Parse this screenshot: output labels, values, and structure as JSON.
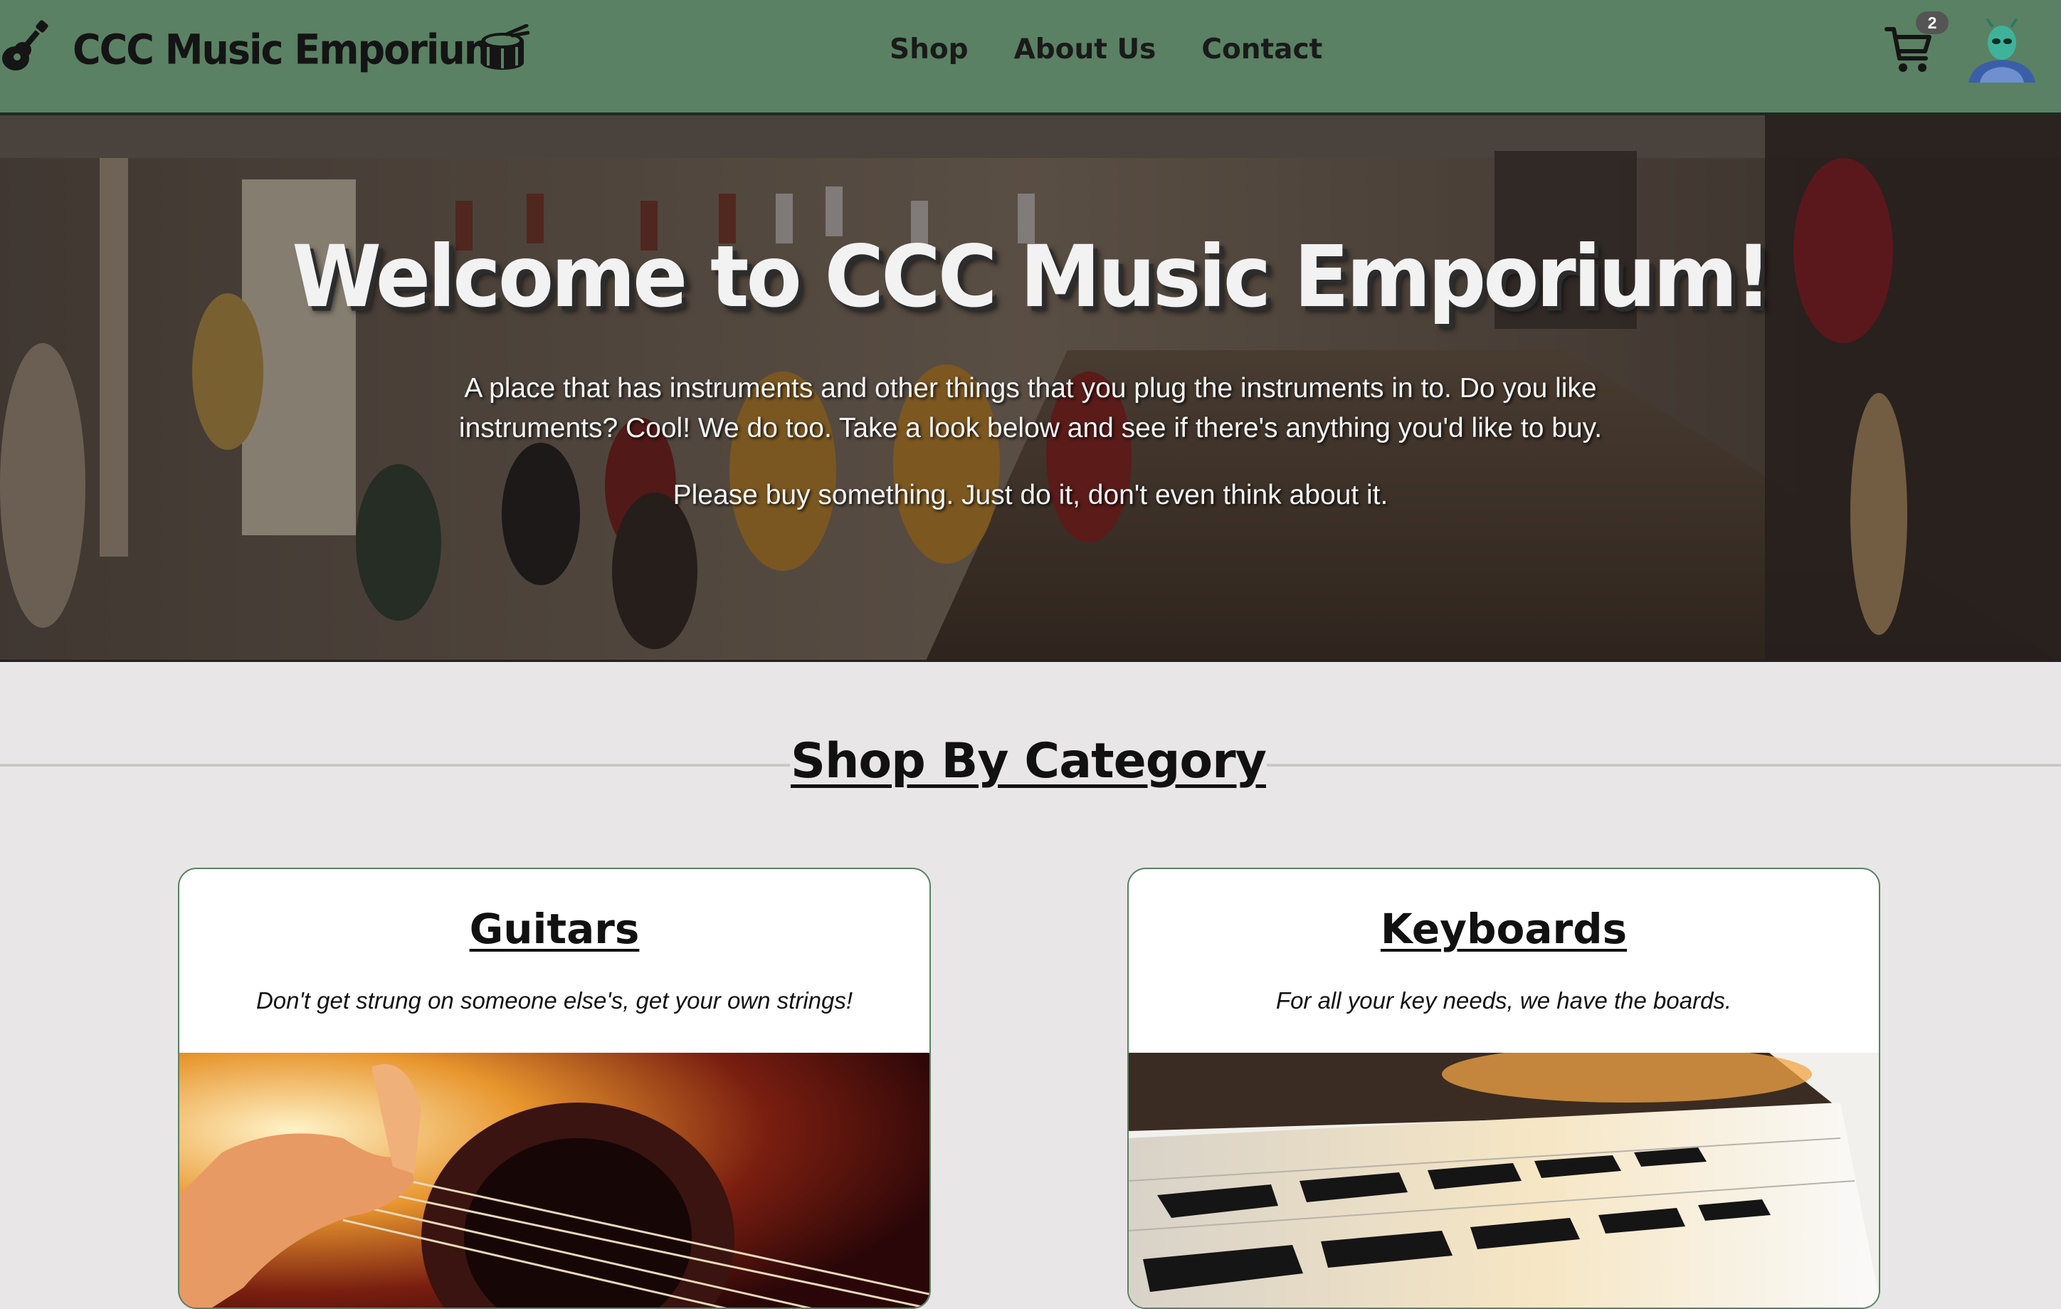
{
  "navbar": {
    "brand": "CCC Music Emporium",
    "links": [
      "Shop",
      "About Us",
      "Contact"
    ],
    "cart_count": "2"
  },
  "hero": {
    "title": "Welcome to CCC Music Emporium!",
    "paragraph1": "A place that has instruments and other things that you plug the instruments in to. Do you like instruments? Cool! We do too. Take a look below and see if there's anything you'd like to buy.",
    "paragraph2": "Please buy something. Just do it, don't even think about it."
  },
  "categories": {
    "heading": "Shop By Category",
    "items": [
      {
        "title": "Guitars",
        "subtitle": "Don't get strung on someone else's, get your own strings!"
      },
      {
        "title": "Keyboards",
        "subtitle": "For all your key needs, we have the boards."
      }
    ]
  },
  "icons": {
    "brand_left": "guitar-icon",
    "brand_right": "drum-icon",
    "cart": "shopping-cart-icon",
    "avatar": "alien-avatar"
  },
  "colors": {
    "navbar": "#5a8163",
    "page_bg": "#e8e6e7",
    "card_border": "#5a8163"
  }
}
